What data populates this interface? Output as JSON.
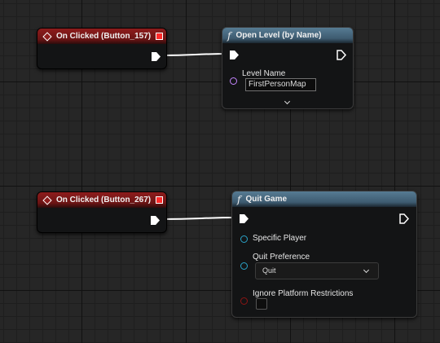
{
  "colors": {
    "event_header": "#8e1c1c",
    "function_header": "#3e5b70",
    "exec_wire": "#ffffff",
    "name_pin": "#c586ff",
    "object_pin": "#2aa3c8",
    "bool_pin": "#8c1515"
  },
  "nodes": {
    "click_157": {
      "title": "On Clicked (Button_157)",
      "icon": "event-diamond-icon"
    },
    "open_level": {
      "title": "Open Level (by Name)",
      "icon": "function-icon",
      "level_name_label": "Level Name",
      "level_name_value": "FirstPersonMap",
      "expand_icon": "chevron-down-icon"
    },
    "click_267": {
      "title": "On Clicked (Button_267)",
      "icon": "event-diamond-icon"
    },
    "quit_game": {
      "title": "Quit Game",
      "icon": "function-icon",
      "specific_player_label": "Specific Player",
      "quit_preference_label": "Quit Preference",
      "quit_preference_value": "Quit",
      "ignore_restrictions_label": "Ignore Platform Restrictions",
      "ignore_restrictions_checked": false
    }
  }
}
